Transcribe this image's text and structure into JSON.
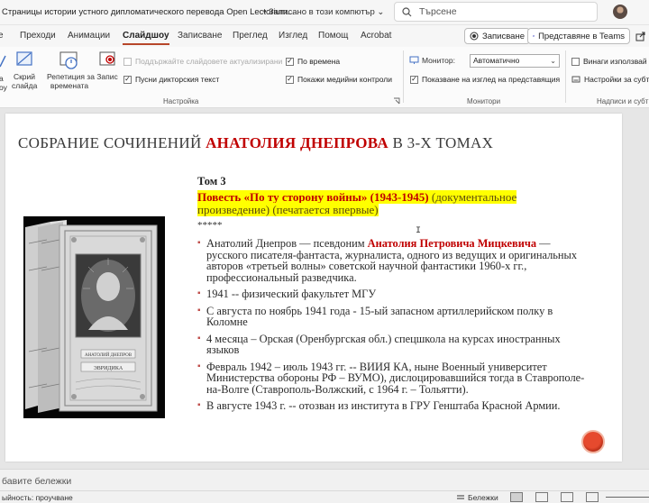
{
  "window": {
    "doc_title": "Страницы истории устного дипломатического перевода Open Lectorium...",
    "save_status": "• Записано в този компютър",
    "save_chevron": "⌄",
    "search_placeholder": "Търсене"
  },
  "tabs": {
    "items": [
      "е",
      "Преходи",
      "Анимации",
      "Слайдшоу",
      "Записване",
      "Преглед",
      "Изглед",
      "Помощ",
      "Acrobat"
    ],
    "active": "Слайдшоу",
    "record_button": "Записване",
    "present_teams_button": "Представяне в Teams"
  },
  "ribbon": {
    "hide_slide_label_1": "Скрий",
    "hide_slide_label_2": "слайда",
    "left_cut_1": "а",
    "left_cut_2": "оу",
    "rehearse_label_1": "Репетиция за",
    "rehearse_label_2": "времената",
    "record_label": "Запис",
    "keep_updated": "Поддържайте слайдовете актуализирани",
    "play_narrations": "Пусни дикторския текст",
    "use_timings": "По времена",
    "show_media_controls": "Покажи медийни контроли",
    "group_setup": "Настройка",
    "monitor_label": "Монитор:",
    "monitor_value": "Автоматично",
    "presenter_view": "Показване на изглед на представящия",
    "group_monitors": "Монитори",
    "always_use": "Винаги използвай",
    "settings_sub": "Настройки за субт",
    "group_captions": "Надписи и субт"
  },
  "slide": {
    "title_prefix": "СОБРАНИЕ СОЧИНЕНИЙ ",
    "title_highlight": "АНАТОЛИЯ ДНЕПРОВА",
    "title_suffix": " В 3-Х ТОМАХ",
    "volume": "Том 3",
    "novel_red": "Повесть «По ту сторону войны» (1943-1945)",
    "novel_rest": " (документальное произведение) (печатается впервые)",
    "stars": "*****",
    "bullets": {
      "b1_prefix": "Анатолий Днепров — псевдоним ",
      "b1_name": "Анатолия Петровича Мицкевича",
      "b1_suffix": " — русского писателя-фантаста, журналиста, одного из ведущих и оригинальных авторов «третьей волны» советской научной фантастики 1960-х гг., профессиональный разведчика.",
      "b2": "1941 -- физический факультет МГУ",
      "b3": "С августа по ноябрь 1941 года - 15-ый запасном артиллерийском полку в Коломне",
      "b4": "4 месяца – Орская (Оренбургская обл.) спецшкола на курсах иностранных языков",
      "b5": " Февраль 1942 – июль 1943 гг.  -- ВИИЯ КА, ныне Военный университет Министерства обороны РФ – ВУМО), дислоцировавшийся тогда в Ставрополе-на-Волге (Ставрополь-Волжский, с 1964 г. – Тольятти).",
      "b6": "В августе 1943 г. -- отозван из института в ГРУ Генштаба Красной Армии."
    },
    "book_spine_author": "АНАТОЛИЙ ДНЕПРОВ",
    "book_cover_title": "ЭВРИДИКА"
  },
  "notes": {
    "placeholder": "бавите бележки"
  },
  "status": {
    "left": "ыйность: проучване",
    "notes_btn": "Бележки"
  },
  "colors": {
    "accent": "#b7472a",
    "title_red": "#c00000",
    "highlight": "#ffff00"
  }
}
